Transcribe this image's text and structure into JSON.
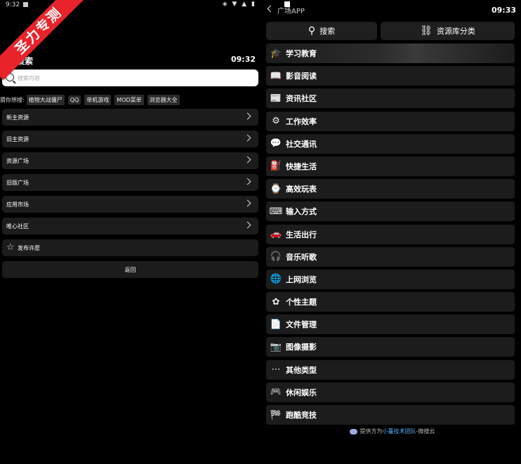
{
  "left": {
    "status": {
      "time": "9:32",
      "icons": "◈ ▼ ▲ ▮"
    },
    "ribbon": "圣力专测",
    "title": "搜索",
    "time": "09:32",
    "search": {
      "placeholder": "搜索内容",
      "value": ""
    },
    "hot": {
      "label": "猜你想搜:",
      "tags": [
        "植物大战僵尸",
        "QQ",
        "单机游戏",
        "MOD菜单",
        "浏览器大全"
      ]
    },
    "items": [
      "新主资源",
      "旧主资源",
      "资源广场",
      "旧版广场",
      "应用市场",
      "唯心社区"
    ],
    "publish": "发布许愿",
    "back": "返回"
  },
  "right": {
    "title": "广场APP",
    "time": "09:33",
    "search_btn": "搜索",
    "category_btn": "资源库分类",
    "categories": [
      {
        "label": "学习教育",
        "icon": "🎓"
      },
      {
        "label": "影音阅读",
        "icon": "📖"
      },
      {
        "label": "资讯社区",
        "icon": "📰"
      },
      {
        "label": "工作效率",
        "icon": "⚙"
      },
      {
        "label": "社交通讯",
        "icon": "💬"
      },
      {
        "label": "快捷生活",
        "icon": "⛽"
      },
      {
        "label": "高效玩表",
        "icon": "⌚"
      },
      {
        "label": "输入方式",
        "icon": "⌨"
      },
      {
        "label": "生活出行",
        "icon": "🚗"
      },
      {
        "label": "音乐听歌",
        "icon": "🎧"
      },
      {
        "label": "上网浏览",
        "icon": "🌐"
      },
      {
        "label": "个性主题",
        "icon": "✿"
      },
      {
        "label": "文件管理",
        "icon": "📄"
      },
      {
        "label": "图像摄影",
        "icon": "📷"
      },
      {
        "label": "其他类型",
        "icon": "⋯"
      },
      {
        "label": "休闲娱乐",
        "icon": "🎮"
      },
      {
        "label": "跑酷竞技",
        "icon": "🏁"
      }
    ],
    "footer": {
      "prefix": "提供方为",
      "highlight": "小蔓技术团队",
      "suffix": "-微搜云"
    }
  }
}
